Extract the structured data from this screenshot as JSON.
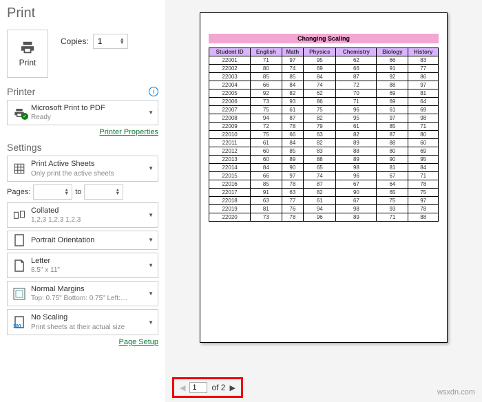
{
  "title": "Print",
  "print_button": "Print",
  "copies_label": "Copies:",
  "copies_value": "1",
  "printer": {
    "heading": "Printer",
    "name": "Microsoft Print to PDF",
    "status": "Ready",
    "properties_link": "Printer Properties"
  },
  "settings": {
    "heading": "Settings",
    "print_what": {
      "main": "Print Active Sheets",
      "sub": "Only print the active sheets"
    },
    "pages_label": "Pages:",
    "pages_from": "",
    "pages_to_label": "to",
    "pages_to": "",
    "collate": {
      "main": "Collated",
      "sub": "1,2,3   1,2,3   1,2,3"
    },
    "orientation": "Portrait Orientation",
    "paper": {
      "main": "Letter",
      "sub": "8.5\" x 11\""
    },
    "margins": {
      "main": "Normal Margins",
      "sub": "Top: 0.75\" Bottom: 0.75\" Left:…"
    },
    "scaling": {
      "main": "No Scaling",
      "sub": "Print sheets at their actual size",
      "badge": "100"
    },
    "page_setup_link": "Page Setup"
  },
  "nav": {
    "current": "1",
    "of_label": "of 2"
  },
  "watermark": "wsxdn.com",
  "chart_data": {
    "type": "table",
    "title": "Changing Scaling",
    "columns": [
      "Student ID",
      "English",
      "Math",
      "Physics",
      "Chemistry",
      "Biology",
      "History"
    ],
    "rows": [
      [
        "22001",
        71,
        97,
        95,
        62,
        66,
        83
      ],
      [
        "22002",
        80,
        74,
        69,
        66,
        91,
        77
      ],
      [
        "22003",
        85,
        85,
        84,
        87,
        92,
        86
      ],
      [
        "22004",
        66,
        84,
        74,
        72,
        88,
        97
      ],
      [
        "22005",
        92,
        82,
        62,
        70,
        69,
        81
      ],
      [
        "22006",
        73,
        93,
        86,
        71,
        69,
        64
      ],
      [
        "22007",
        75,
        61,
        75,
        96,
        61,
        69
      ],
      [
        "22008",
        94,
        87,
        82,
        95,
        97,
        98
      ],
      [
        "22009",
        72,
        78,
        79,
        61,
        85,
        71
      ],
      [
        "22010",
        75,
        66,
        63,
        82,
        87,
        80
      ],
      [
        "22011",
        61,
        84,
        82,
        89,
        88,
        60
      ],
      [
        "22012",
        60,
        85,
        83,
        88,
        80,
        69
      ],
      [
        "22013",
        60,
        89,
        88,
        89,
        90,
        95
      ],
      [
        "22014",
        84,
        90,
        65,
        98,
        81,
        84
      ],
      [
        "22015",
        66,
        97,
        74,
        96,
        67,
        71
      ],
      [
        "22016",
        85,
        78,
        87,
        67,
        64,
        78
      ],
      [
        "22017",
        91,
        63,
        82,
        90,
        65,
        75
      ],
      [
        "22018",
        63,
        77,
        61,
        67,
        75,
        97
      ],
      [
        "22019",
        81,
        76,
        94,
        98,
        93,
        78
      ],
      [
        "22020",
        73,
        78,
        96,
        89,
        71,
        88
      ]
    ]
  }
}
